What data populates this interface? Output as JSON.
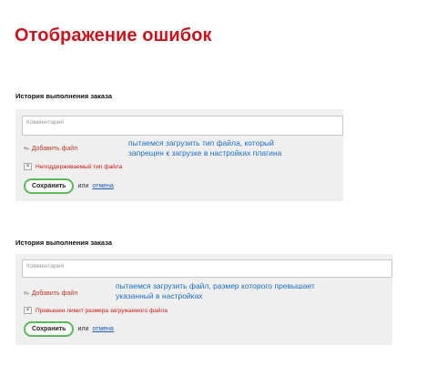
{
  "page_title": "Отображение ошибок",
  "section_title": "История выполнения заказа",
  "blocks": [
    {
      "comment_placeholder": "Комментарий",
      "attach_label": "Добавить файл",
      "note_line1": "пытаемся загрузить тип файла, который",
      "note_line2": "запрещен к загрузке в настройках плагина",
      "error_text": "Неподдерживаемый тип файла",
      "save_label": "Сохранить",
      "or_text": "или",
      "cancel_label": "отмена"
    },
    {
      "comment_placeholder": "Комментарий",
      "attach_label": "Добавить файл",
      "note_line1": "пытаемся загрузить файл, размер которого превышает",
      "note_line2": "указанный в настройках",
      "error_text": "Превышен лимит размера загружаемого файла",
      "save_label": "Сохранить",
      "or_text": "или",
      "cancel_label": "отмена"
    }
  ],
  "colors": {
    "title": "#c8141e",
    "error": "#d01818",
    "note": "#1e6fc0",
    "save_border": "#5cb85c"
  }
}
